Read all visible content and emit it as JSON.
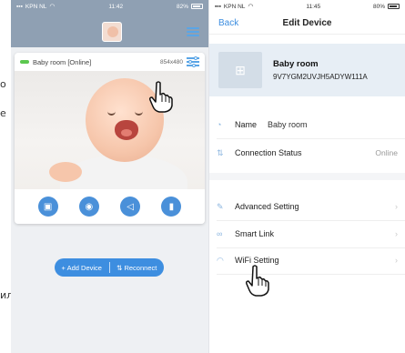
{
  "margin_text": {
    "frag1": "o",
    "frag2": "e",
    "frag3": "ил"
  },
  "left_phone": {
    "status": {
      "carrier": "KPN NL",
      "time": "11:42",
      "battery": "82%"
    },
    "camera": {
      "name": "Baby room [Online]",
      "resolution": "854x480",
      "status_color": "#5cc74f"
    },
    "controls": [
      "image-icon",
      "camera-icon",
      "speaker-icon",
      "mic-icon"
    ],
    "actions": {
      "add_device": "+ Add Device",
      "reconnect": "Reconnect",
      "reconnect_glyph": "⇅"
    }
  },
  "right_phone": {
    "status": {
      "carrier": "KPN NL",
      "time": "11:45",
      "battery": "80%"
    },
    "nav": {
      "back": "Back",
      "title": "Edit Device"
    },
    "device": {
      "name": "Baby room",
      "id": "9V7YGM2UVJH5ADYW111A"
    },
    "rows": {
      "name_label": "Name",
      "name_value": "Baby room",
      "connection_label": "Connection Status",
      "connection_value": "Online",
      "advanced_label": "Advanced Setting",
      "smartlink_label": "Smart Link",
      "wifi_label": "WiFi Setting"
    }
  },
  "colors": {
    "accent": "#3d8ee0",
    "header": "#8fa0b3",
    "online": "#5cc74f"
  }
}
